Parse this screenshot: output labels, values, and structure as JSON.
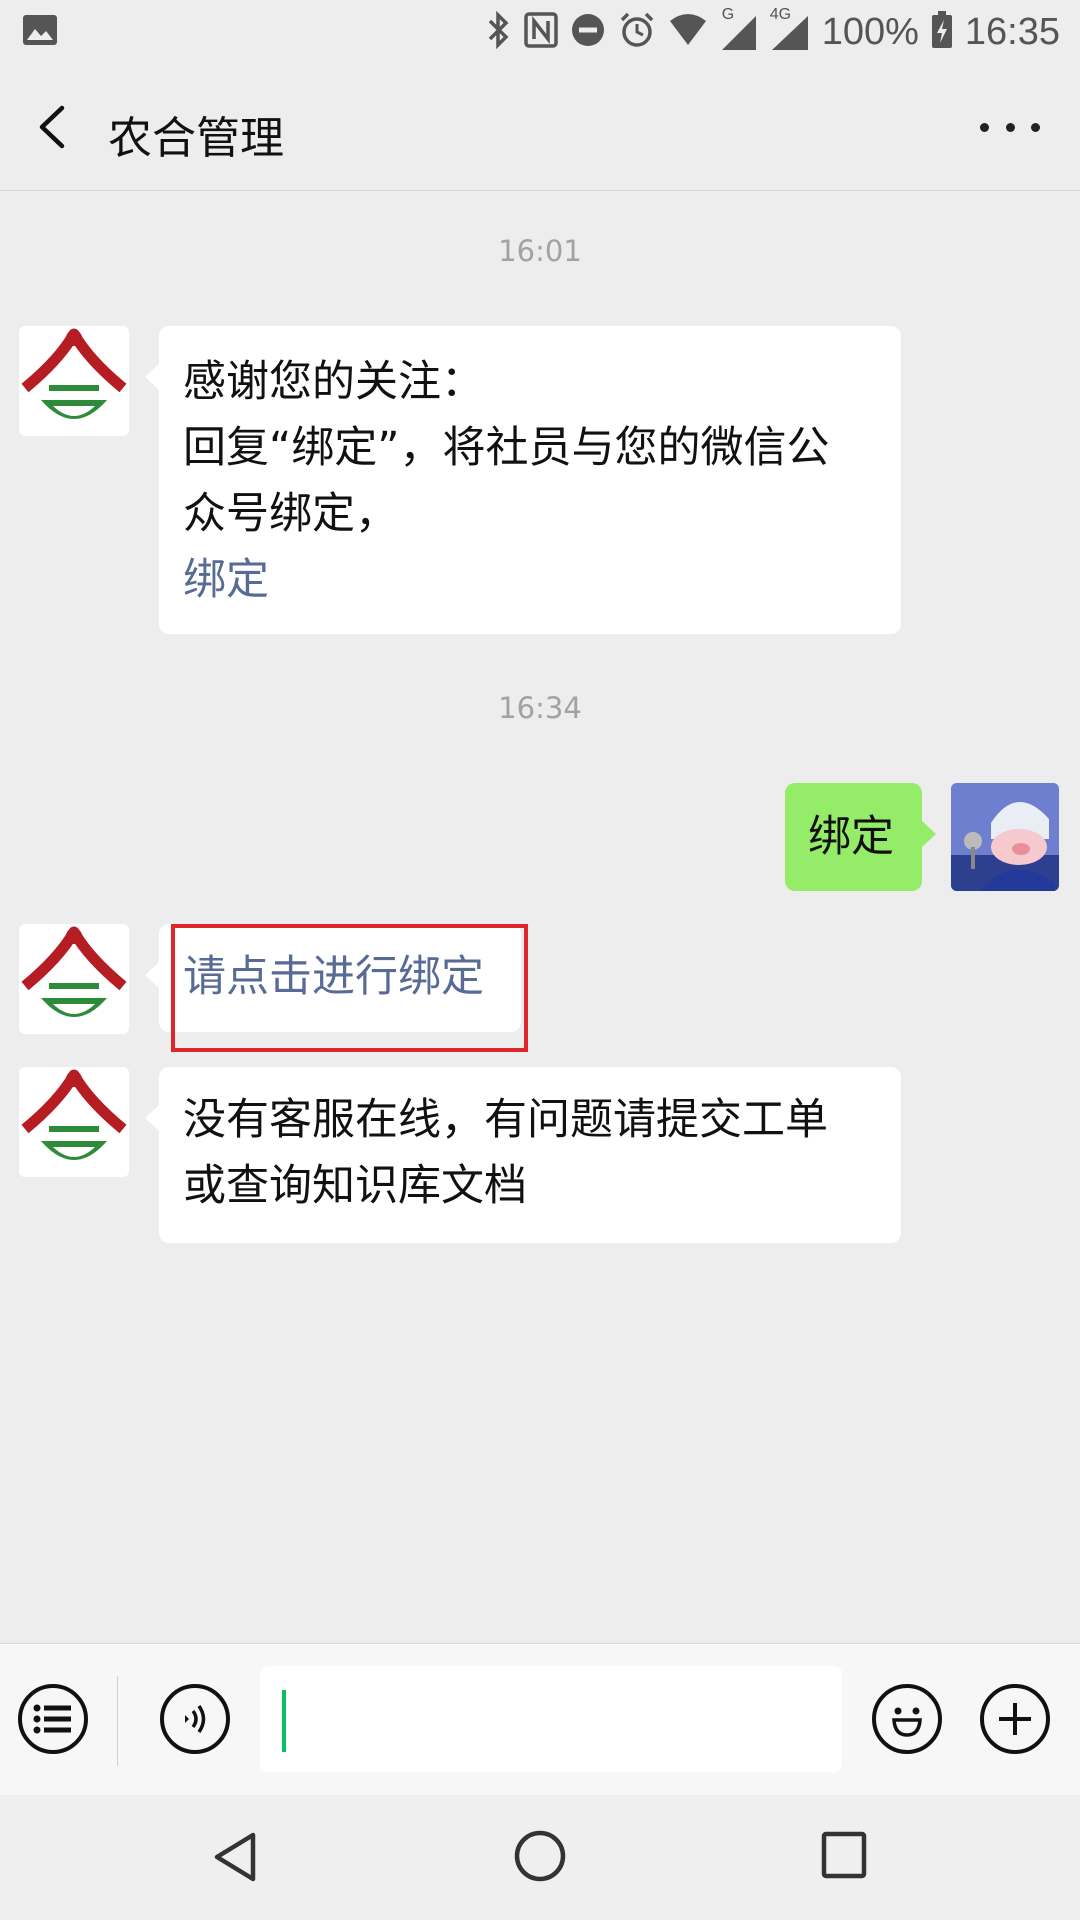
{
  "status_bar": {
    "battery": "100%",
    "time": "16:35",
    "network_g": "G",
    "network_4g": "4G"
  },
  "header": {
    "title": "农合管理"
  },
  "messages": {
    "time_1": "16:01",
    "welcome": {
      "line1": "感谢您的关注：",
      "line2": "回复“绑定”，将社员与您的微信公",
      "line3": "众号绑定，",
      "link": "绑定"
    },
    "time_2": "16:34",
    "user_message": "绑定",
    "bind_link": "请点击进行绑定",
    "service_offline": {
      "line1": "没有客服在线，有问题请提交工单",
      "line2": "或查询知识库文档"
    }
  },
  "colors": {
    "link": "#576b95",
    "outgoing_bubble": "#95ec69",
    "highlight_box": "#e0252b",
    "caret": "#07c160"
  }
}
